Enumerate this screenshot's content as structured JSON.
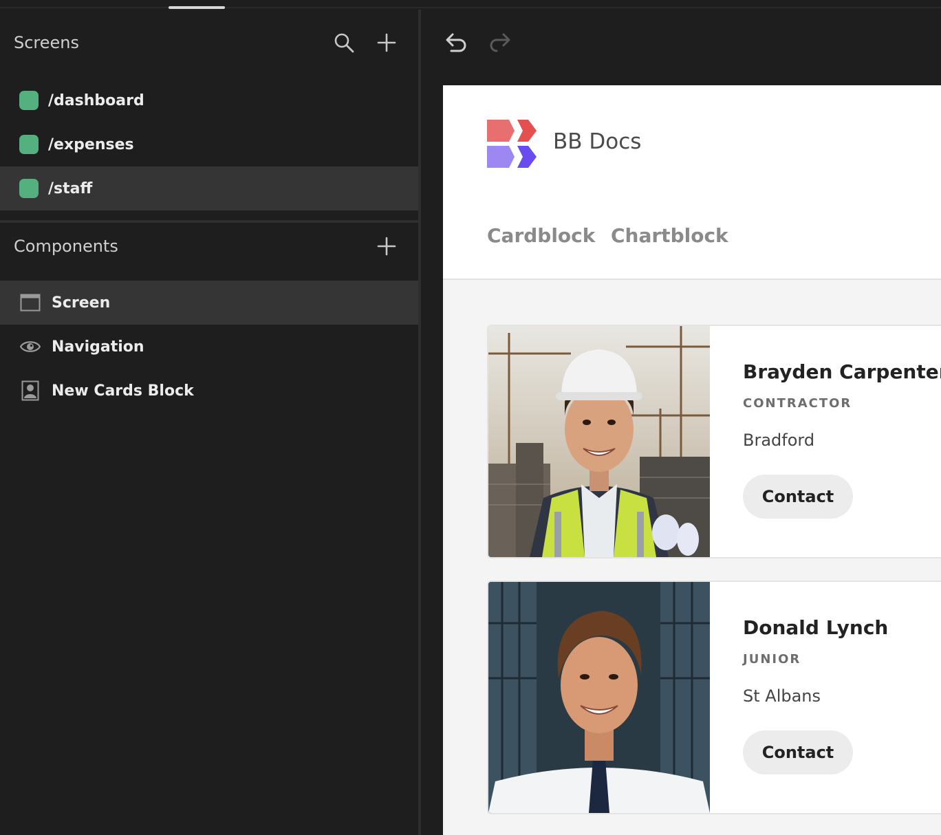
{
  "screens_panel": {
    "title": "Screens",
    "items": [
      {
        "label": "/dashboard",
        "selected": false
      },
      {
        "label": "/expenses",
        "selected": false
      },
      {
        "label": "/staff",
        "selected": true
      }
    ],
    "search_icon": "search-icon",
    "add_icon": "plus-icon"
  },
  "components_panel": {
    "title": "Components",
    "items": [
      {
        "label": "Screen",
        "icon": "window-icon",
        "selected": true
      },
      {
        "label": "Navigation",
        "icon": "eye-icon",
        "selected": false
      },
      {
        "label": "New Cards Block",
        "icon": "person-card-icon",
        "selected": false
      }
    ],
    "add_icon": "plus-icon"
  },
  "toolbar": {
    "undo_icon": "undo-icon",
    "redo_icon": "redo-icon"
  },
  "preview": {
    "brand": "BB Docs",
    "nav": [
      "Cardblock",
      "Chartblock"
    ],
    "cards": [
      {
        "name": "Brayden Carpenter",
        "role": "CONTRACTOR",
        "location": "Bradford",
        "button": "Contact"
      },
      {
        "name": "Donald Lynch",
        "role": "JUNIOR",
        "location": "St Albans",
        "button": "Contact"
      }
    ]
  },
  "colors": {
    "screen_dot": "#54b07e",
    "logo_red_light": "#e86f6f",
    "logo_red": "#e44f4f",
    "logo_purple_light": "#9d87f0",
    "logo_purple": "#6a4bf0"
  }
}
